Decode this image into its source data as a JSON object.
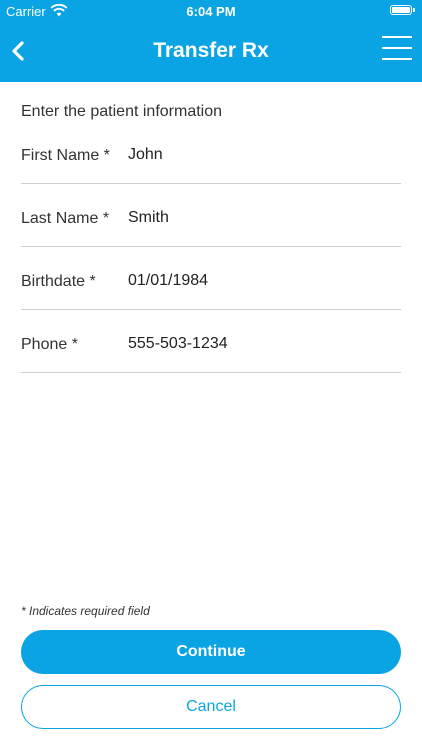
{
  "status_bar": {
    "carrier": "Carrier",
    "time": "6:04 PM",
    "wifi_icon": "wifi-icon",
    "battery_icon": "battery-icon"
  },
  "nav": {
    "title": "Transfer Rx",
    "back_icon": "chevron-left-icon",
    "menu_icon": "hamburger-menu-icon",
    "bar_color": "#0aa3e3"
  },
  "form": {
    "intro": "Enter the patient information",
    "fields": [
      {
        "label": "First Name *",
        "value": "John"
      },
      {
        "label": "Last Name *",
        "value": "Smith"
      },
      {
        "label": "Birthdate *",
        "value": "01/01/1984"
      },
      {
        "label": "Phone *",
        "value": "555-503-1234"
      }
    ],
    "required_note": "* Indicates required field"
  },
  "actions": {
    "continue_label": "Continue",
    "cancel_label": "Cancel",
    "accent_color": "#0aa3e3"
  }
}
